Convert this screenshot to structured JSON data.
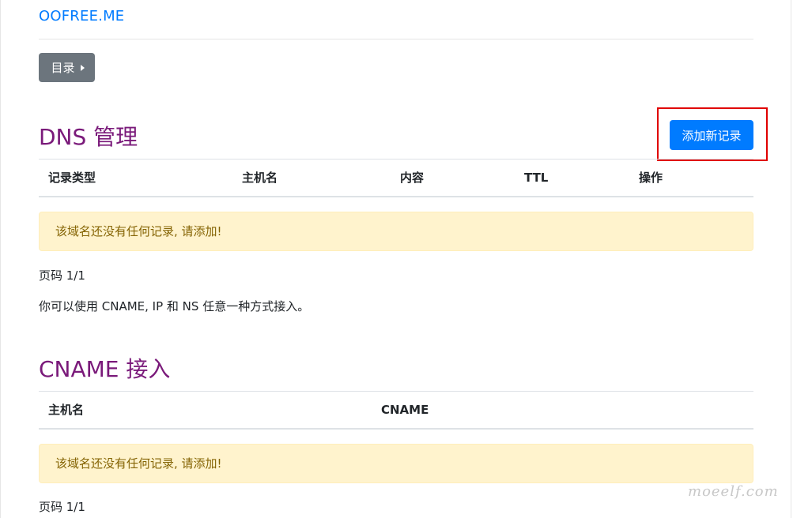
{
  "header": {
    "brand": "OOFREE.ME",
    "menu_button_label": "目录"
  },
  "dns_section": {
    "title": "DNS 管理",
    "add_button_label": "添加新记录",
    "columns": [
      "记录类型",
      "主机名",
      "内容",
      "TTL",
      "操作"
    ],
    "empty_notice": "该域名还没有任何记录, 请添加!",
    "pagination": "页码 1/1",
    "hint": "你可以使用 CNAME, IP 和 NS 任意一种方式接入。"
  },
  "cname_section": {
    "title": "CNAME 接入",
    "columns": [
      "主机名",
      "CNAME"
    ],
    "empty_notice": "该域名还没有任何记录, 请添加!",
    "pagination": "页码 1/1"
  },
  "watermark": "moeelf.com",
  "colors": {
    "brand_link": "#007bff",
    "section_title": "#7a1a7a",
    "menu_button_bg": "#6c757d",
    "primary_button_bg": "#007bff",
    "alert_bg": "#fff3cd",
    "alert_text": "#856404",
    "highlight_border": "#e00000"
  },
  "icons": {
    "menu_caret": "caret-right-icon"
  }
}
